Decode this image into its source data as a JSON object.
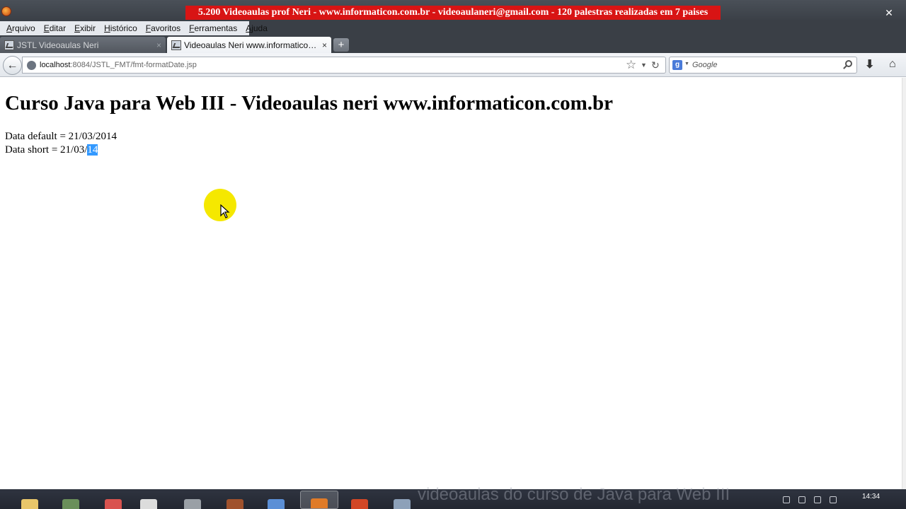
{
  "window": {
    "banner": "5.200 Videoaulas prof Neri - www.informaticon.com.br - videoaulaneri@gmail.com - 120 palestras realizadas em 7 paises",
    "close_glyph": "✕"
  },
  "menu": [
    "Arquivo",
    "Editar",
    "Exibir",
    "Histórico",
    "Favoritos",
    "Ferramentas",
    "Ajuda"
  ],
  "tabs": [
    {
      "label": "JSTL Videoaulas Neri",
      "active": false
    },
    {
      "label": "Videoaulas Neri www.informaticon.c...",
      "active": true
    }
  ],
  "tab_close_glyph": "×",
  "new_tab_glyph": "+",
  "navbar": {
    "back_glyph": "←",
    "url_host": "localhost",
    "url_rest": ":8084/JSTL_FMT/fmt-formatDate.jsp",
    "search_engine_letter": "g",
    "search_placeholder": "Google",
    "star_glyph": "☆",
    "drop_glyph": "▼",
    "reload_glyph": "↻",
    "download_glyph": "⬇",
    "home_glyph": "⌂"
  },
  "page": {
    "title": "Curso Java para Web III - Videoaulas neri www.informaticon.com.br",
    "line1": "Data default = 21/03/2014",
    "line2_prefix": "Data short = 21/03/",
    "line2_selected": "14"
  },
  "taskbar": {
    "watermark": "videoaulas do curso de Java para Web III",
    "clock": "14:34",
    "apps": [
      {
        "name": "folder",
        "color": "#e8c66a"
      },
      {
        "name": "tool",
        "color": "#6a8f5a"
      },
      {
        "name": "chrome",
        "color": "#d9534f"
      },
      {
        "name": "notepad",
        "color": "#dcdcdc"
      },
      {
        "name": "pen",
        "color": "#9aa0a6"
      },
      {
        "name": "archive",
        "color": "#a0522d"
      },
      {
        "name": "monitor",
        "color": "#5b8fd6"
      },
      {
        "name": "firefox",
        "color": "#e07b28",
        "active": true
      },
      {
        "name": "powerpoint",
        "color": "#d24726"
      },
      {
        "name": "database",
        "color": "#8da1b9"
      }
    ]
  }
}
